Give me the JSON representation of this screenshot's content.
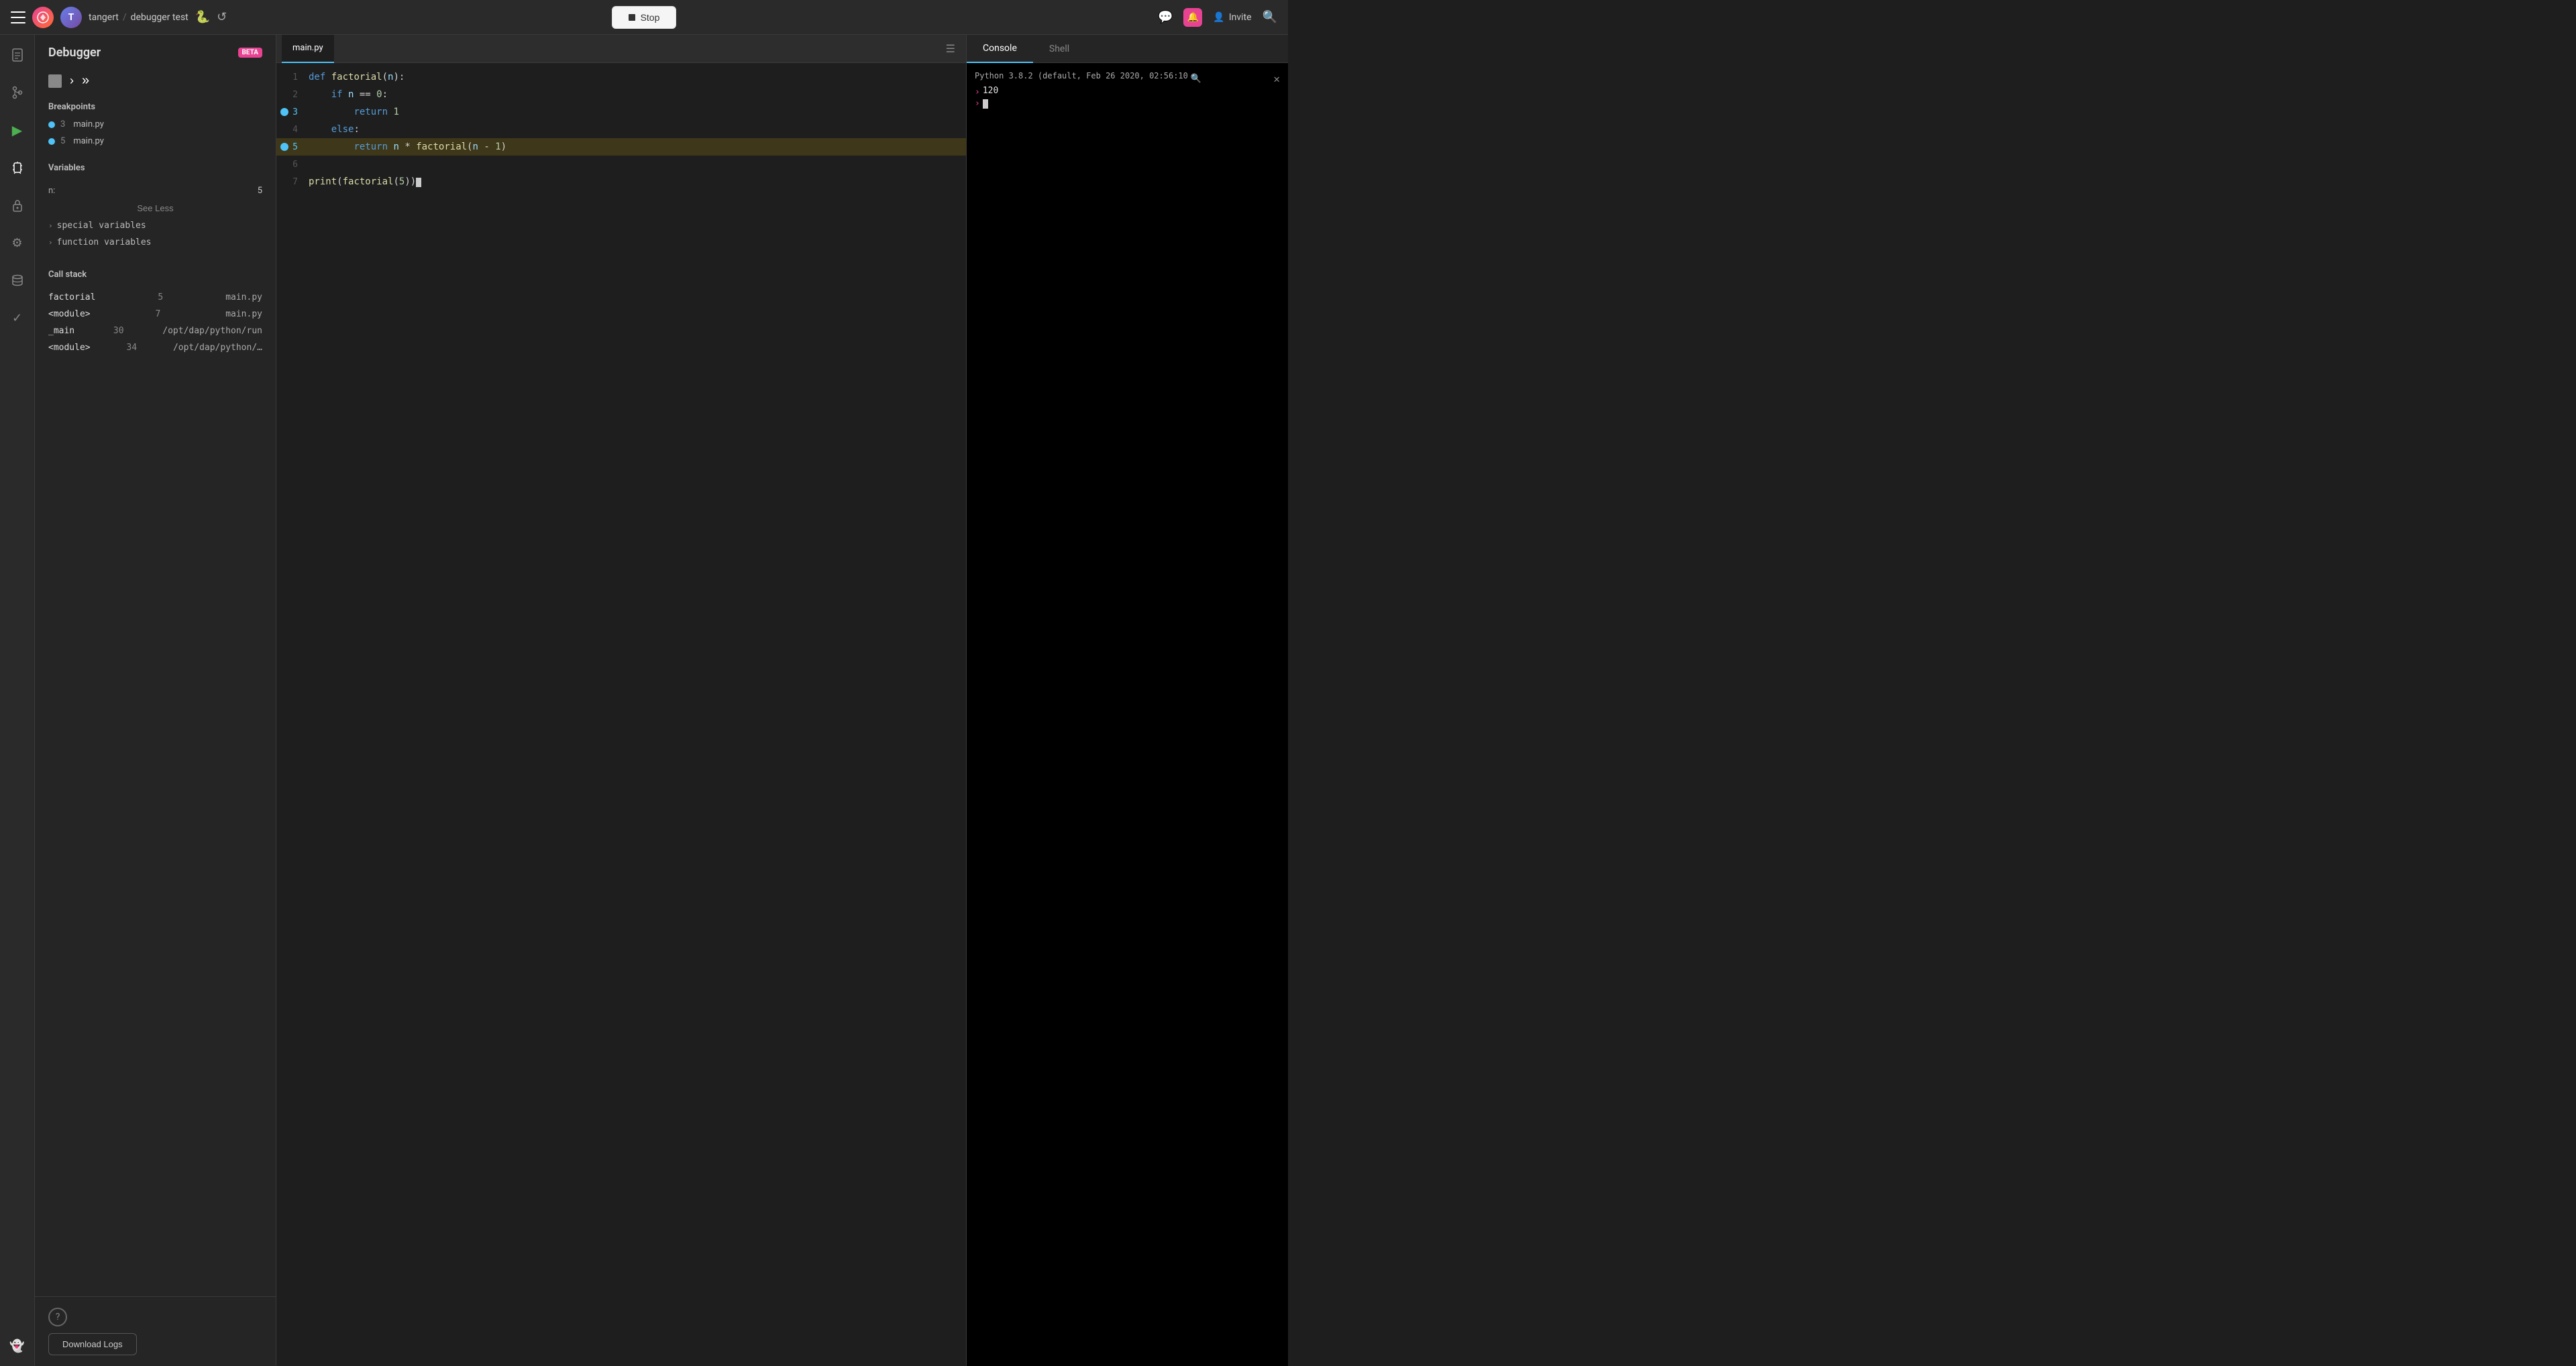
{
  "topbar": {
    "app_name": "tangert",
    "separator": "/",
    "project_name": "debugger test",
    "stop_label": "Stop",
    "invite_label": "Invite"
  },
  "sidebar": {
    "title": "Debugger",
    "beta_label": "BETA",
    "breakpoints_title": "Breakpoints",
    "breakpoints": [
      {
        "line": 3,
        "file": "main.py"
      },
      {
        "line": 5,
        "file": "main.py"
      }
    ],
    "variables_title": "Variables",
    "variables": [
      {
        "key": "n:",
        "value": "5"
      }
    ],
    "see_less_label": "See Less",
    "special_variables_label": "special variables",
    "function_variables_label": "function variables",
    "callstack_title": "Call stack",
    "callstack": [
      {
        "name": "factorial",
        "line": "5",
        "file": "main.py"
      },
      {
        "name": "<module>",
        "line": "7",
        "file": "main.py"
      },
      {
        "name": "_main",
        "line": "30",
        "file": "/opt/dap/python/run"
      },
      {
        "name": "<module>",
        "line": "34",
        "file": "/opt/dap/python/…"
      }
    ],
    "download_logs_label": "Download Logs"
  },
  "editor": {
    "tab_name": "main.py",
    "lines": [
      {
        "num": 1,
        "code": "def factorial(n):",
        "type": "normal"
      },
      {
        "num": 2,
        "code": "    if n == 0:",
        "type": "normal"
      },
      {
        "num": 3,
        "code": "        return 1",
        "type": "breakpoint"
      },
      {
        "num": 4,
        "code": "    else:",
        "type": "normal"
      },
      {
        "num": 5,
        "code": "        return n * factorial(n - 1)",
        "type": "current_breakpoint"
      },
      {
        "num": 6,
        "code": "",
        "type": "normal"
      },
      {
        "num": 7,
        "code": "print(factorial(5))",
        "type": "normal"
      }
    ]
  },
  "console": {
    "console_tab_label": "Console",
    "shell_tab_label": "Shell",
    "header_text": "Python 3.8.2 (default, Feb 26 2020, 02:56:10",
    "output_line": "120",
    "prompt_arrow": "›"
  }
}
